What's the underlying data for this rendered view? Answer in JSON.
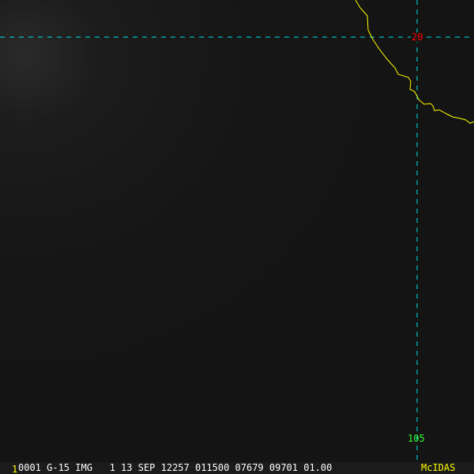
{
  "image": {
    "grid": {
      "latitude_label": "20",
      "longitude_label": "105"
    },
    "colors": {
      "grid": "#00e5e5",
      "coastline": "#ffff00",
      "lat_label": "#ff0000",
      "lon_label": "#33ff33"
    }
  },
  "status_bar": {
    "frame_number": "1",
    "text": "0001 G-15 IMG   1 13 SEP 12257 011500 07679 09701 01.00",
    "brand": "McIDAS"
  }
}
